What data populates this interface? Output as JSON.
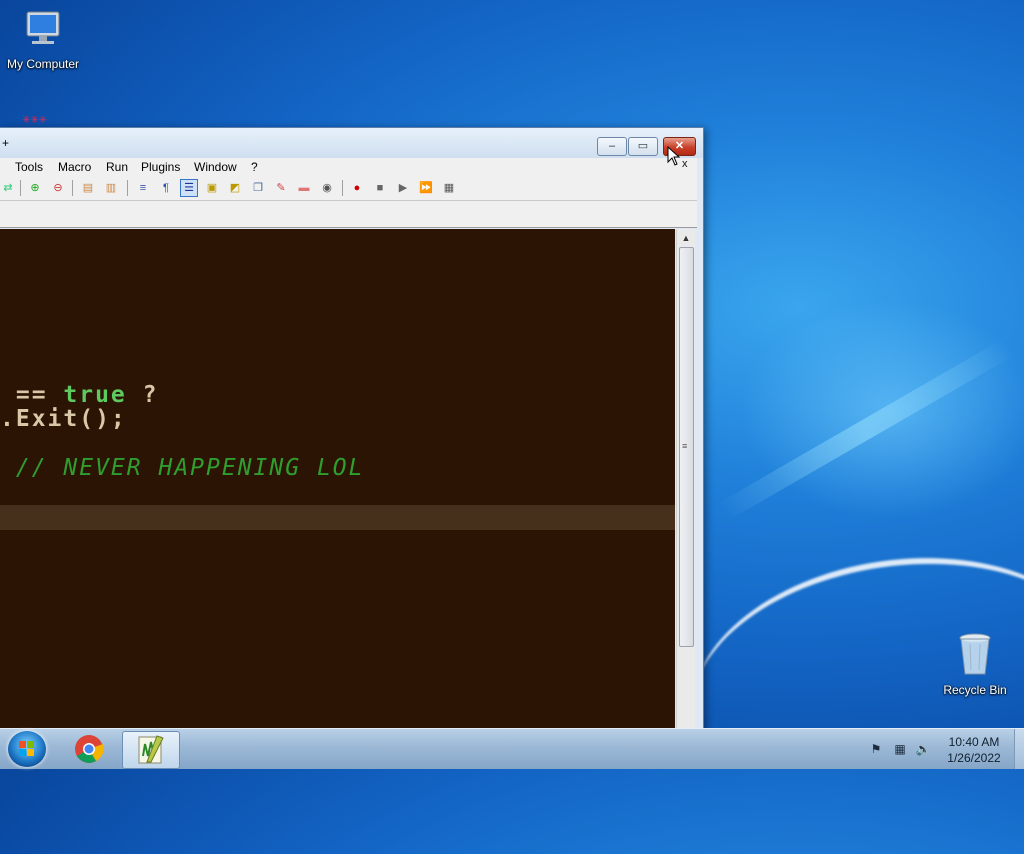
{
  "desktop": {
    "icons": [
      {
        "label": "My Computer"
      },
      {
        "label": "Recycle Bin"
      }
    ]
  },
  "window": {
    "title": "+",
    "buttons": {
      "minimize": "–",
      "maximize": "▭",
      "close": "✕"
    },
    "menu": [
      "Tools",
      "Macro",
      "Run",
      "Plugins",
      "Window",
      "?"
    ],
    "editor": {
      "lines": [
        {
          "parts": [
            {
              "text": " == ",
              "color": "#d8c8a8"
            },
            {
              "text": "true",
              "color": "#5ec95e"
            },
            {
              "text": " ?",
              "color": "#d8c8a8"
            }
          ]
        },
        {
          "parts": [
            {
              "text": ".Exit();",
              "color": "#d8c8a8"
            }
          ]
        },
        {
          "parts": [
            {
              "text": " // NEVER HAPPENING LOL",
              "color": "#2f9e2f"
            }
          ]
        }
      ],
      "colors": {
        "background": "#2b1404",
        "current_line": "#46301c"
      }
    }
  },
  "taskbar": {
    "clock_time": "10:40 AM",
    "clock_date": "1/26/2022"
  },
  "cursor_hint": "x"
}
